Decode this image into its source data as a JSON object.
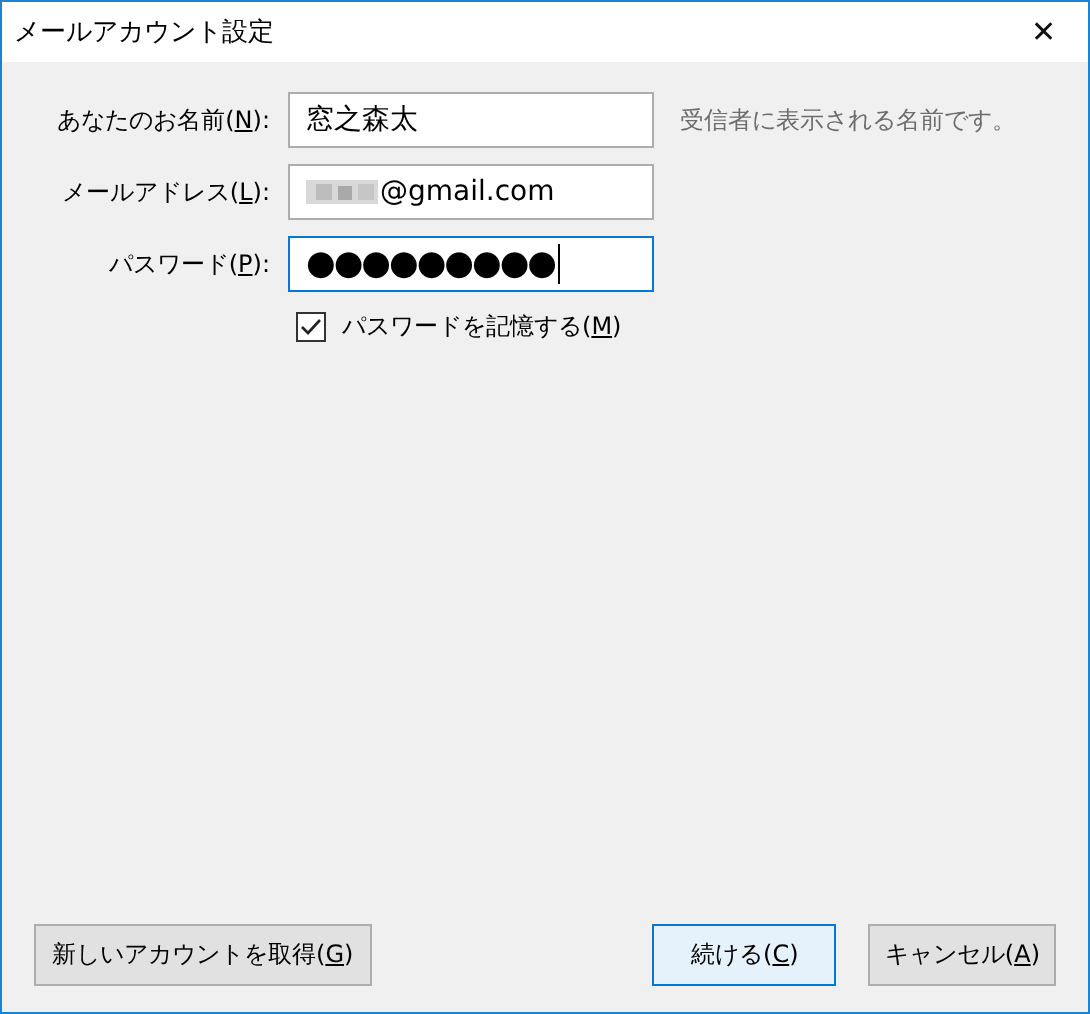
{
  "window": {
    "title": "メールアカウント設定",
    "close": "✕"
  },
  "fields": [
    {
      "label": [
        "あなたのお名前(",
        "N",
        "):"
      ],
      "value": "窓之森太",
      "hint": "受信者に表示される名前です。",
      "focused": false,
      "kind": "text"
    },
    {
      "label": [
        "メールアドレス(",
        "L",
        "):"
      ],
      "value": "@gmail.com",
      "focused": false,
      "kind": "email"
    },
    {
      "label": [
        "パスワード(",
        "P",
        "):"
      ],
      "value": "●●●●●●●●●",
      "focused": true,
      "kind": "password"
    }
  ],
  "remember": {
    "label": [
      "パスワードを記憶する(",
      "M",
      ")"
    ],
    "checked": true
  },
  "buttons": [
    {
      "label": [
        "新しいアカウントを取得(",
        "G",
        ")"
      ],
      "default": false
    },
    {
      "label": [
        "続ける(",
        "C",
        ")"
      ],
      "default": true
    },
    {
      "label": [
        "キャンセル(",
        "A",
        ")"
      ],
      "default": false
    }
  ]
}
